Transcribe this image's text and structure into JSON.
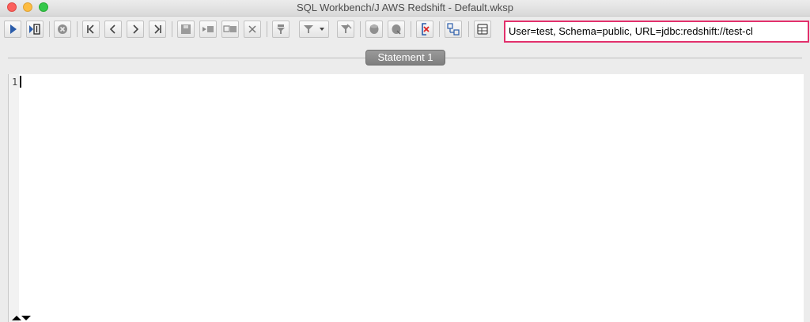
{
  "window": {
    "title": "SQL Workbench/J AWS Redshift - Default.wksp"
  },
  "toolbar": {
    "connection_info": "User=test, Schema=public, URL=jdbc:redshift://test-cl"
  },
  "editor": {
    "tab_label": "Statement 1",
    "line_number": "1",
    "content": ""
  }
}
